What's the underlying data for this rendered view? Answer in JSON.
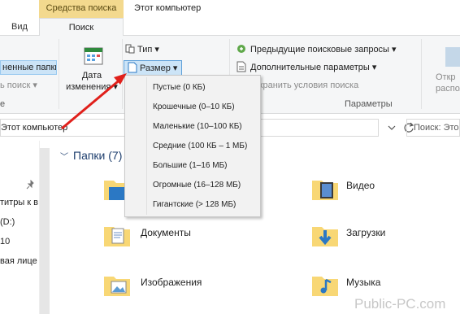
{
  "window": {
    "context_tab": "Средства поиска",
    "title": "Этот компьютер"
  },
  "tabs": [
    {
      "label": "Вид"
    },
    {
      "label": "Поиск"
    }
  ],
  "ribbon": {
    "subfolders_label": "ненные папки",
    "search_again_label": "ь поиск ▾",
    "left_group_label": "е",
    "date_modified_label": "Дата\nизменения ▾",
    "type_label": "Тип ▾",
    "size_label": "Размер ▾",
    "prev_searches_label": "Предыдущие поисковые запросы ▾",
    "advanced_options_label": "Дополнительные параметры ▾",
    "save_search_label": "хранить условия поиска",
    "options_group_label": "Параметры",
    "open_location_label": "Откр\nрасположен"
  },
  "address": {
    "path": "Этот компьютер",
    "search_placeholder": "Поиск: Это"
  },
  "nav": {
    "items": [
      "титры к в",
      "(D:)",
      "10",
      "вая лице"
    ]
  },
  "content": {
    "group_header": "Папки (7)",
    "folders": [
      {
        "name": "Видео",
        "icon": "video-folder-icon"
      },
      {
        "name": "Документы",
        "icon": "documents-folder-icon"
      },
      {
        "name": "Загрузки",
        "icon": "downloads-folder-icon"
      },
      {
        "name": "Изображения",
        "icon": "pictures-folder-icon"
      },
      {
        "name": "Музыка",
        "icon": "music-folder-icon"
      }
    ]
  },
  "size_menu": {
    "items": [
      "Пустые (0 КБ)",
      "Крошечные (0–10 КБ)",
      "Маленькие (10–100 КБ)",
      "Средние (100 КБ – 1 МБ)",
      "Большие (1–16 МБ)",
      "Огромные (16–128 МБ)",
      "Гигантские (> 128 МБ)"
    ]
  },
  "watermark": "Public-PC.com",
  "colors": {
    "context_tab_bg": "#f3d98e",
    "selected_bg": "#cce4f7",
    "folder_yellow": "#f8d775",
    "annotation_arrow": "#e0201b"
  }
}
